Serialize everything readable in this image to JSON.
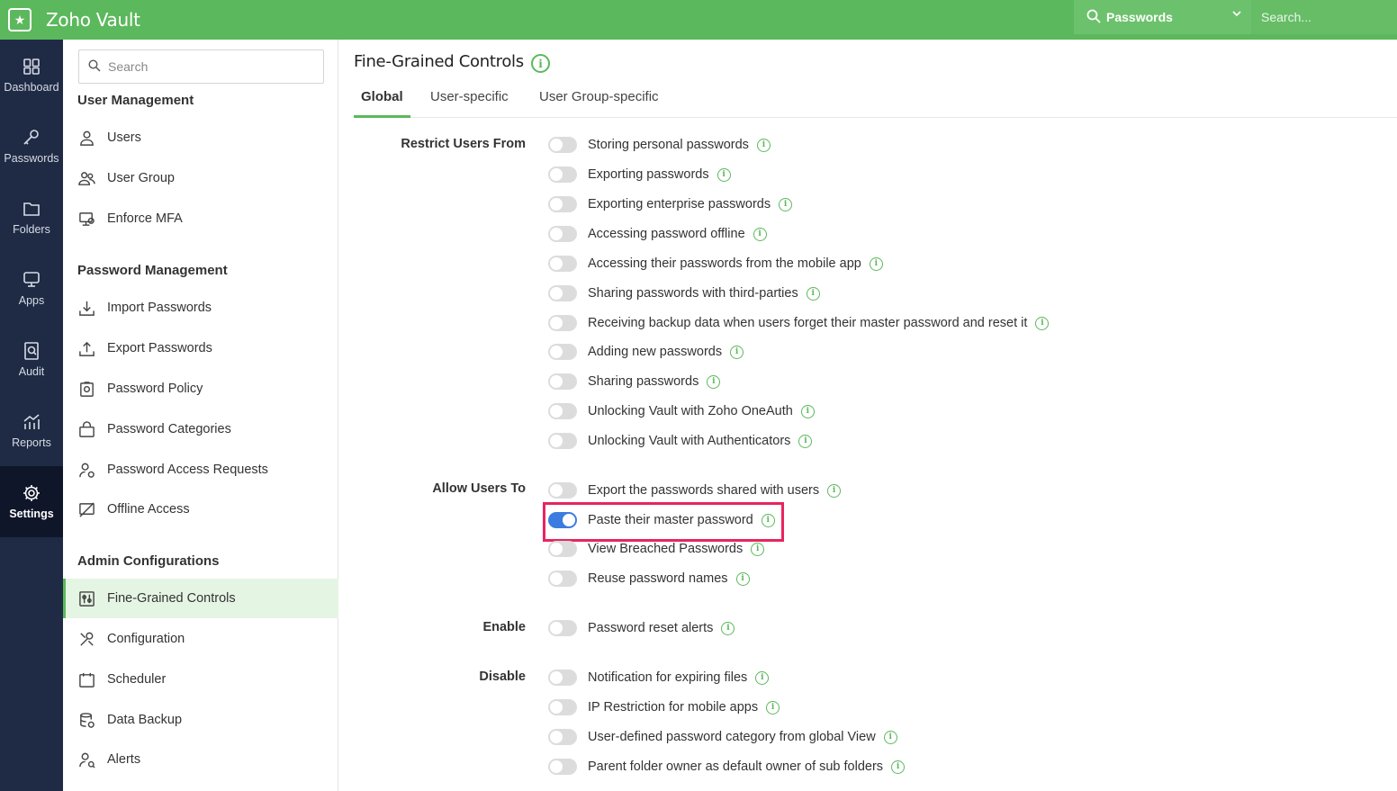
{
  "topbar": {
    "app_title": "Zoho Vault",
    "search_scope": "Passwords",
    "search_placeholder": "Search..."
  },
  "rail": [
    {
      "label": "Dashboard",
      "icon": "dashboard-icon"
    },
    {
      "label": "Passwords",
      "icon": "key-icon"
    },
    {
      "label": "Folders",
      "icon": "folder-icon"
    },
    {
      "label": "Apps",
      "icon": "apps-icon"
    },
    {
      "label": "Audit",
      "icon": "audit-icon"
    },
    {
      "label": "Reports",
      "icon": "reports-icon"
    },
    {
      "label": "Settings",
      "icon": "gear-icon",
      "active": true
    }
  ],
  "sidebar": {
    "search_placeholder": "Search",
    "sections": [
      {
        "heading": "User Management",
        "items": [
          "Users",
          "User Group",
          "Enforce MFA"
        ]
      },
      {
        "heading": "Password Management",
        "items": [
          "Import Passwords",
          "Export Passwords",
          "Password Policy",
          "Password Categories",
          "Password Access Requests",
          "Offline Access"
        ]
      },
      {
        "heading": "Admin Configurations",
        "items": [
          "Fine-Grained Controls",
          "Configuration",
          "Scheduler",
          "Data Backup",
          "Alerts"
        ]
      }
    ],
    "active_item": "Fine-Grained Controls"
  },
  "main": {
    "title": "Fine-Grained Controls",
    "tabs": [
      "Global",
      "User-specific",
      "User Group-specific"
    ],
    "active_tab": "Global",
    "groups": [
      {
        "label": "Restrict Users From",
        "options": [
          {
            "text": "Storing personal passwords",
            "on": false
          },
          {
            "text": "Exporting passwords",
            "on": false
          },
          {
            "text": "Exporting enterprise passwords",
            "on": false
          },
          {
            "text": "Accessing password offline",
            "on": false
          },
          {
            "text": "Accessing their passwords from the mobile app",
            "on": false
          },
          {
            "text": "Sharing passwords with third-parties",
            "on": false
          },
          {
            "text": "Receiving backup data when users forget their master password and reset it",
            "on": false
          },
          {
            "text": "Adding new passwords",
            "on": false
          },
          {
            "text": "Sharing passwords",
            "on": false
          },
          {
            "text": "Unlocking Vault with Zoho OneAuth",
            "on": false
          },
          {
            "text": "Unlocking Vault with Authenticators",
            "on": false
          }
        ]
      },
      {
        "label": "Allow Users To",
        "options": [
          {
            "text": "Export the passwords shared with users",
            "on": false
          },
          {
            "text": "Paste their master password",
            "on": true
          },
          {
            "text": "View Breached Passwords",
            "on": false
          },
          {
            "text": "Reuse password names",
            "on": false
          }
        ]
      },
      {
        "label": "Enable",
        "options": [
          {
            "text": "Password reset alerts",
            "on": false
          }
        ]
      },
      {
        "label": "Disable",
        "options": [
          {
            "text": "Notification for expiring files",
            "on": false
          },
          {
            "text": "IP Restriction for mobile apps",
            "on": false
          },
          {
            "text": "User-defined password category from global View",
            "on": false
          },
          {
            "text": "Parent folder owner as default owner of sub folders",
            "on": false
          }
        ]
      }
    ]
  },
  "colors": {
    "brand_green": "#5cb85c",
    "rail_bg": "#1f2a44",
    "toggle_on": "#3c7ce0",
    "highlight": "#e8245e"
  }
}
